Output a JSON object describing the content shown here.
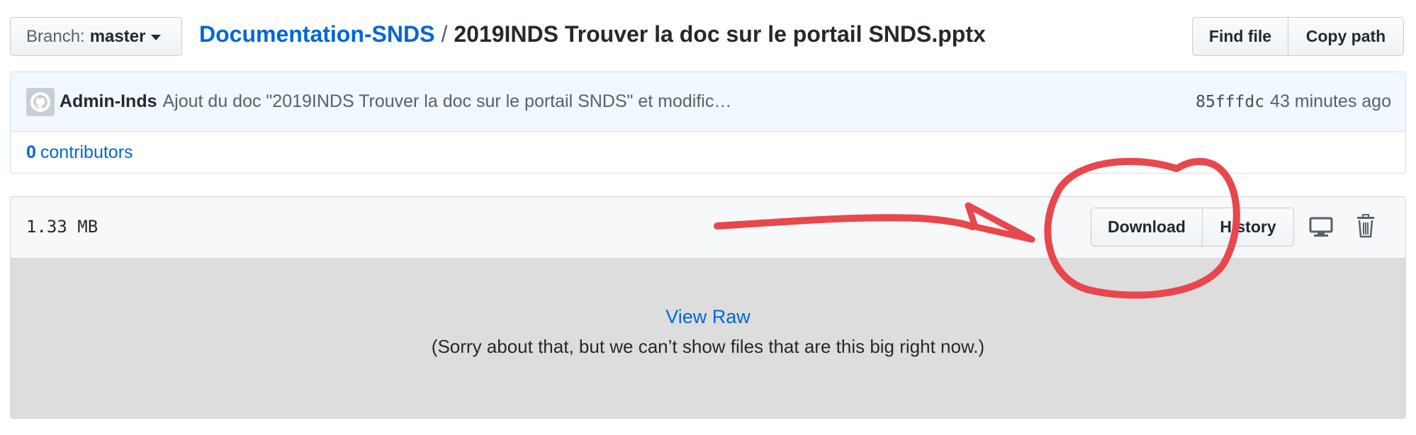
{
  "header": {
    "branch_label": "Branch:",
    "branch_value": "master",
    "repo_name": "Documentation-SNDS",
    "separator": "/",
    "file_name": "2019INDS Trouver la doc sur le portail SNDS.pptx",
    "find_file_label": "Find file",
    "copy_path_label": "Copy path"
  },
  "commit": {
    "author": "Admin-Inds",
    "message": "Ajout du doc \"2019INDS Trouver la doc sur le portail SNDS\" et modific…",
    "sha": "85fffdc",
    "time": "43 minutes ago",
    "contributors_count": "0",
    "contributors_label": "contributors"
  },
  "file": {
    "size": "1.33 MB",
    "download_label": "Download",
    "history_label": "History",
    "view_raw_label": "View Raw",
    "notice": "(Sorry about that, but we can’t show files that are this big right now.)"
  },
  "icons": {
    "branch_caret": "caret-down-icon",
    "avatar": "github-avatar-icon",
    "desktop": "desktop-icon",
    "trash": "trash-icon"
  },
  "colors": {
    "link": "#0366d6",
    "annotation": "#e8474c",
    "commit_bg": "#f1f8ff",
    "file_body_bg": "#dddddd"
  }
}
